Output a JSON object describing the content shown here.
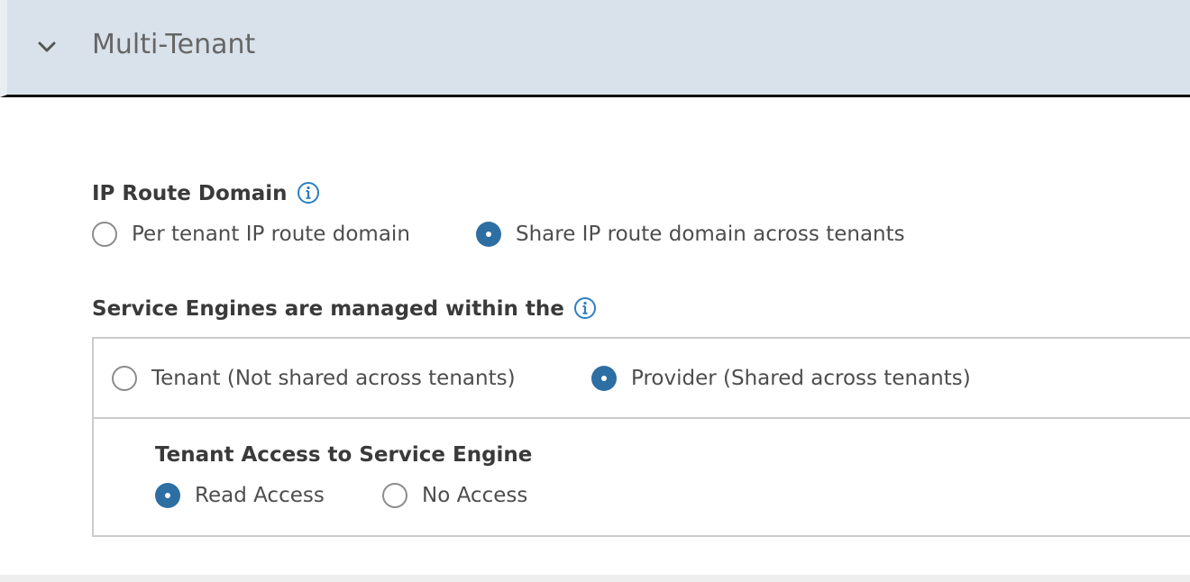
{
  "section": {
    "title": "Multi-Tenant",
    "expanded": true,
    "header_bg": "#d9e2ea"
  },
  "ip_route_domain": {
    "label": "IP Route Domain",
    "options": [
      {
        "label": "Per tenant IP route domain",
        "selected": false
      },
      {
        "label": "Share IP route domain across tenants",
        "selected": true
      }
    ]
  },
  "service_engines": {
    "label": "Service Engines are managed within the",
    "options": [
      {
        "label": "Tenant (Not shared across tenants)",
        "selected": false
      },
      {
        "label": "Provider (Shared across tenants)",
        "selected": true
      }
    ],
    "tenant_access": {
      "label": "Tenant Access to Service Engine",
      "options": [
        {
          "label": "Read Access",
          "selected": true
        },
        {
          "label": "No Access",
          "selected": false
        }
      ]
    }
  },
  "colors": {
    "accent": "#2d6ea3",
    "info_icon": "#2d7fc1",
    "border": "#cccccc"
  },
  "icons": {
    "collapse": "chevron-down-icon",
    "info": "info-circle-icon"
  }
}
